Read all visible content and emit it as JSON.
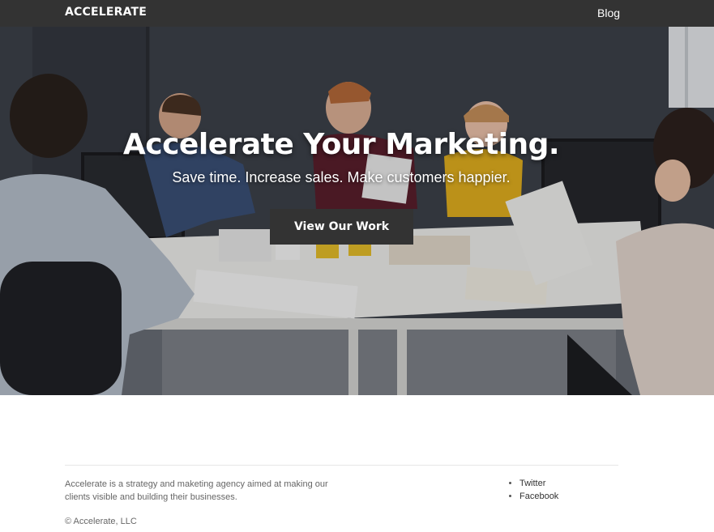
{
  "header": {
    "brand": "ACCELERATE",
    "nav": [
      {
        "label": "Blog"
      }
    ]
  },
  "hero": {
    "title": "Accelerate Your Marketing.",
    "subtitle": "Save time. Increase sales. Make customers happier.",
    "cta_label": "View Our Work",
    "background_image": "office-team-meeting-photo"
  },
  "footer": {
    "about": "Accelerate is a strategy and maketing agency aimed at making our clients visible and building their businesses.",
    "links": [
      {
        "label": "Twitter"
      },
      {
        "label": "Facebook"
      }
    ],
    "copyright": "© Accelerate, LLC"
  },
  "colors": {
    "header_bg": "#333333",
    "button_bg": "#333333",
    "text_white": "#ffffff",
    "footer_text": "#666666"
  }
}
